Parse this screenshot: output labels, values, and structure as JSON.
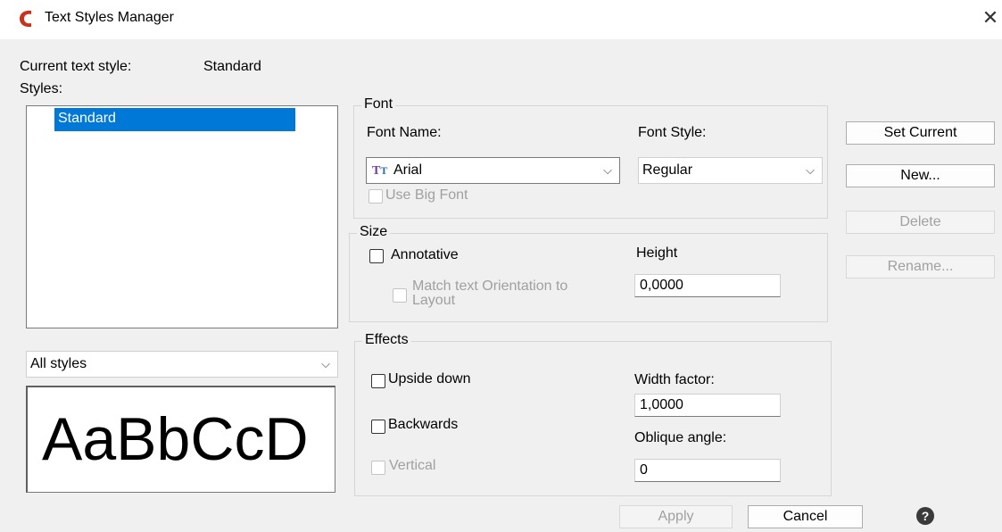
{
  "window": {
    "title": "Text Styles Manager",
    "close_glyph": "✕",
    "brand_color": "#c8331f"
  },
  "current_style": {
    "label": "Current text style:",
    "value": "Standard"
  },
  "styles": {
    "label": "Styles:",
    "items": [
      "Standard"
    ],
    "selected": "Standard",
    "filter_value": "All styles"
  },
  "preview": {
    "sample": "AaBbCcD"
  },
  "font": {
    "group_label": "Font",
    "name_label": "Font Name:",
    "name_value": "Arial",
    "name_icon": "truetype-font-icon",
    "style_label": "Font Style:",
    "style_value": "Regular",
    "big_font_label": "Use Big Font"
  },
  "size": {
    "group_label": "Size",
    "annotative_label": "Annotative",
    "match_orientation_label_1": "Match text Orientation to",
    "match_orientation_label_2": "Layout",
    "height_label": "Height",
    "height_value": "0,0000"
  },
  "effects": {
    "group_label": "Effects",
    "upside_down_label": "Upside down",
    "backwards_label": "Backwards",
    "vertical_label": "Vertical",
    "width_factor_label": "Width factor:",
    "width_factor_value": "1,0000",
    "oblique_angle_label": "Oblique angle:",
    "oblique_angle_value": "0"
  },
  "buttons": {
    "set_current": "Set Current",
    "new": "New...",
    "delete": "Delete",
    "rename": "Rename...",
    "apply": "Apply",
    "cancel": "Cancel",
    "help": "?"
  },
  "chevron_glyph": "⌵"
}
